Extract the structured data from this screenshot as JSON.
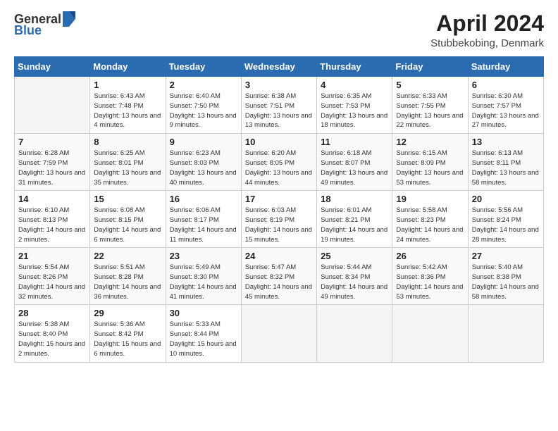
{
  "header": {
    "logo_general": "General",
    "logo_blue": "Blue",
    "month_year": "April 2024",
    "location": "Stubbekobing, Denmark"
  },
  "days_of_week": [
    "Sunday",
    "Monday",
    "Tuesday",
    "Wednesday",
    "Thursday",
    "Friday",
    "Saturday"
  ],
  "weeks": [
    [
      {
        "day": "",
        "sunrise": "",
        "sunset": "",
        "daylight": ""
      },
      {
        "day": "1",
        "sunrise": "6:43 AM",
        "sunset": "7:48 PM",
        "daylight": "13 hours and 4 minutes."
      },
      {
        "day": "2",
        "sunrise": "6:40 AM",
        "sunset": "7:50 PM",
        "daylight": "13 hours and 9 minutes."
      },
      {
        "day": "3",
        "sunrise": "6:38 AM",
        "sunset": "7:51 PM",
        "daylight": "13 hours and 13 minutes."
      },
      {
        "day": "4",
        "sunrise": "6:35 AM",
        "sunset": "7:53 PM",
        "daylight": "13 hours and 18 minutes."
      },
      {
        "day": "5",
        "sunrise": "6:33 AM",
        "sunset": "7:55 PM",
        "daylight": "13 hours and 22 minutes."
      },
      {
        "day": "6",
        "sunrise": "6:30 AM",
        "sunset": "7:57 PM",
        "daylight": "13 hours and 27 minutes."
      }
    ],
    [
      {
        "day": "7",
        "sunrise": "6:28 AM",
        "sunset": "7:59 PM",
        "daylight": "13 hours and 31 minutes."
      },
      {
        "day": "8",
        "sunrise": "6:25 AM",
        "sunset": "8:01 PM",
        "daylight": "13 hours and 35 minutes."
      },
      {
        "day": "9",
        "sunrise": "6:23 AM",
        "sunset": "8:03 PM",
        "daylight": "13 hours and 40 minutes."
      },
      {
        "day": "10",
        "sunrise": "6:20 AM",
        "sunset": "8:05 PM",
        "daylight": "13 hours and 44 minutes."
      },
      {
        "day": "11",
        "sunrise": "6:18 AM",
        "sunset": "8:07 PM",
        "daylight": "13 hours and 49 minutes."
      },
      {
        "day": "12",
        "sunrise": "6:15 AM",
        "sunset": "8:09 PM",
        "daylight": "13 hours and 53 minutes."
      },
      {
        "day": "13",
        "sunrise": "6:13 AM",
        "sunset": "8:11 PM",
        "daylight": "13 hours and 58 minutes."
      }
    ],
    [
      {
        "day": "14",
        "sunrise": "6:10 AM",
        "sunset": "8:13 PM",
        "daylight": "14 hours and 2 minutes."
      },
      {
        "day": "15",
        "sunrise": "6:08 AM",
        "sunset": "8:15 PM",
        "daylight": "14 hours and 6 minutes."
      },
      {
        "day": "16",
        "sunrise": "6:06 AM",
        "sunset": "8:17 PM",
        "daylight": "14 hours and 11 minutes."
      },
      {
        "day": "17",
        "sunrise": "6:03 AM",
        "sunset": "8:19 PM",
        "daylight": "14 hours and 15 minutes."
      },
      {
        "day": "18",
        "sunrise": "6:01 AM",
        "sunset": "8:21 PM",
        "daylight": "14 hours and 19 minutes."
      },
      {
        "day": "19",
        "sunrise": "5:58 AM",
        "sunset": "8:23 PM",
        "daylight": "14 hours and 24 minutes."
      },
      {
        "day": "20",
        "sunrise": "5:56 AM",
        "sunset": "8:24 PM",
        "daylight": "14 hours and 28 minutes."
      }
    ],
    [
      {
        "day": "21",
        "sunrise": "5:54 AM",
        "sunset": "8:26 PM",
        "daylight": "14 hours and 32 minutes."
      },
      {
        "day": "22",
        "sunrise": "5:51 AM",
        "sunset": "8:28 PM",
        "daylight": "14 hours and 36 minutes."
      },
      {
        "day": "23",
        "sunrise": "5:49 AM",
        "sunset": "8:30 PM",
        "daylight": "14 hours and 41 minutes."
      },
      {
        "day": "24",
        "sunrise": "5:47 AM",
        "sunset": "8:32 PM",
        "daylight": "14 hours and 45 minutes."
      },
      {
        "day": "25",
        "sunrise": "5:44 AM",
        "sunset": "8:34 PM",
        "daylight": "14 hours and 49 minutes."
      },
      {
        "day": "26",
        "sunrise": "5:42 AM",
        "sunset": "8:36 PM",
        "daylight": "14 hours and 53 minutes."
      },
      {
        "day": "27",
        "sunrise": "5:40 AM",
        "sunset": "8:38 PM",
        "daylight": "14 hours and 58 minutes."
      }
    ],
    [
      {
        "day": "28",
        "sunrise": "5:38 AM",
        "sunset": "8:40 PM",
        "daylight": "15 hours and 2 minutes."
      },
      {
        "day": "29",
        "sunrise": "5:36 AM",
        "sunset": "8:42 PM",
        "daylight": "15 hours and 6 minutes."
      },
      {
        "day": "30",
        "sunrise": "5:33 AM",
        "sunset": "8:44 PM",
        "daylight": "15 hours and 10 minutes."
      },
      {
        "day": "",
        "sunrise": "",
        "sunset": "",
        "daylight": ""
      },
      {
        "day": "",
        "sunrise": "",
        "sunset": "",
        "daylight": ""
      },
      {
        "day": "",
        "sunrise": "",
        "sunset": "",
        "daylight": ""
      },
      {
        "day": "",
        "sunrise": "",
        "sunset": "",
        "daylight": ""
      }
    ]
  ],
  "labels": {
    "sunrise": "Sunrise:",
    "sunset": "Sunset:",
    "daylight": "Daylight:"
  }
}
